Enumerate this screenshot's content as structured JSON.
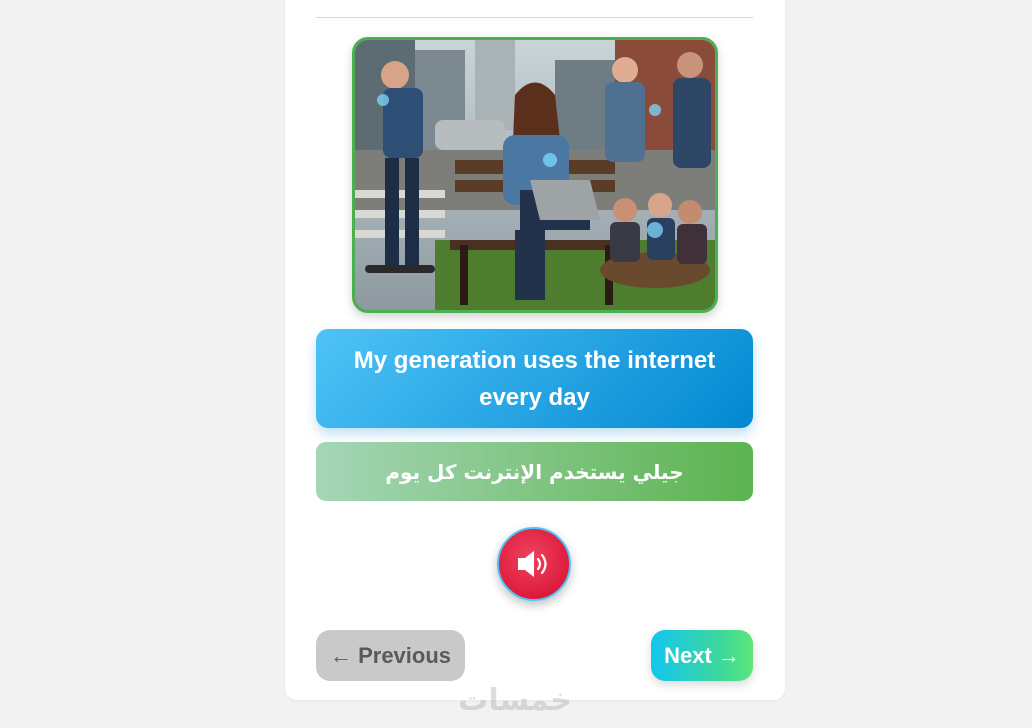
{
  "lesson": {
    "english_sentence": "My generation uses the internet every day",
    "arabic_translation": "جيلي يستخدم الإنترنت كل يوم"
  },
  "illustration": {
    "icon": "illustration-image"
  },
  "audio": {
    "icon": "speaker-icon"
  },
  "navigation": {
    "previous_label": "← Previous",
    "next_label": "Next →"
  },
  "watermark": {
    "text": "خمسات"
  },
  "colors": {
    "english_box_start": "#4fc3f7",
    "english_box_end": "#0288d1",
    "arabic_box_start": "#a5d6b7",
    "arabic_box_end": "#5cb34f",
    "audio_button": "#dc1b3d",
    "image_border": "#4caf50",
    "next_start": "#12c6f0",
    "next_end": "#5ee67a",
    "prev_bg": "#c9c9c9"
  }
}
